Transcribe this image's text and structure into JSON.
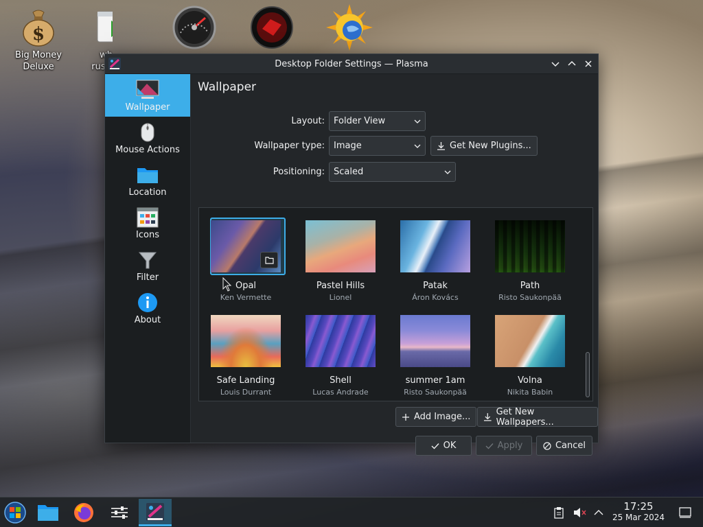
{
  "desktop": {
    "icons": [
      {
        "label_line1": "Big Money",
        "label_line2": "Deluxe",
        "icon": "money-bag-icon"
      },
      {
        "label_line1": "wh",
        "label_line2": "russi",
        "icon": "video-player-icon"
      },
      {
        "label": "",
        "icon": "speedometer-icon"
      },
      {
        "label": "",
        "icon": "red-disc-icon"
      },
      {
        "label": "",
        "icon": "sun-globe-icon"
      }
    ]
  },
  "window": {
    "title": "Desktop Folder Settings — Plasma",
    "controls": [
      "minimize",
      "maximize",
      "close"
    ]
  },
  "sidebar": {
    "items": [
      {
        "label": "Wallpaper",
        "icon": "monitor-icon",
        "active": true
      },
      {
        "label": "Mouse Actions",
        "icon": "mouse-icon"
      },
      {
        "label": "Location",
        "icon": "folder-icon"
      },
      {
        "label": "Icons",
        "icon": "icons-icon"
      },
      {
        "label": "Filter",
        "icon": "filter-icon"
      },
      {
        "label": "About",
        "icon": "info-icon"
      }
    ]
  },
  "main": {
    "title": "Wallpaper",
    "layout": {
      "label": "Layout:",
      "value": "Folder View"
    },
    "wallpaper_type": {
      "label": "Wallpaper type:",
      "value": "Image",
      "button": "Get New Plugins..."
    },
    "positioning": {
      "label": "Positioning:",
      "value": "Scaled"
    },
    "wallpapers": [
      {
        "name": "Opal",
        "author": "Ken Vermette",
        "selected": true
      },
      {
        "name": "Pastel Hills",
        "author": "Lionel"
      },
      {
        "name": "Patak",
        "author": "Áron Kovács"
      },
      {
        "name": "Path",
        "author": "Risto Saukonpää"
      },
      {
        "name": "Safe Landing",
        "author": "Louis Durrant"
      },
      {
        "name": "Shell",
        "author": "Lucas Andrade"
      },
      {
        "name": "summer 1am",
        "author": "Risto Saukonpää"
      },
      {
        "name": "Volna",
        "author": "Nikita Babin"
      }
    ],
    "add_image": "Add Image...",
    "get_new_wallpapers": "Get New Wallpapers...",
    "ok": "OK",
    "apply": "Apply",
    "cancel": "Cancel"
  },
  "taskbar": {
    "time": "17:25",
    "date": "25 Mar 2024",
    "tasks": [
      "start-menu-icon",
      "file-manager-icon",
      "firefox-icon",
      "settings-mixer-icon",
      "plasma-settings-icon"
    ],
    "tray": [
      "clipboard-icon",
      "volume-muted-icon",
      "expand-tray-icon",
      "show-desktop-icon"
    ]
  }
}
